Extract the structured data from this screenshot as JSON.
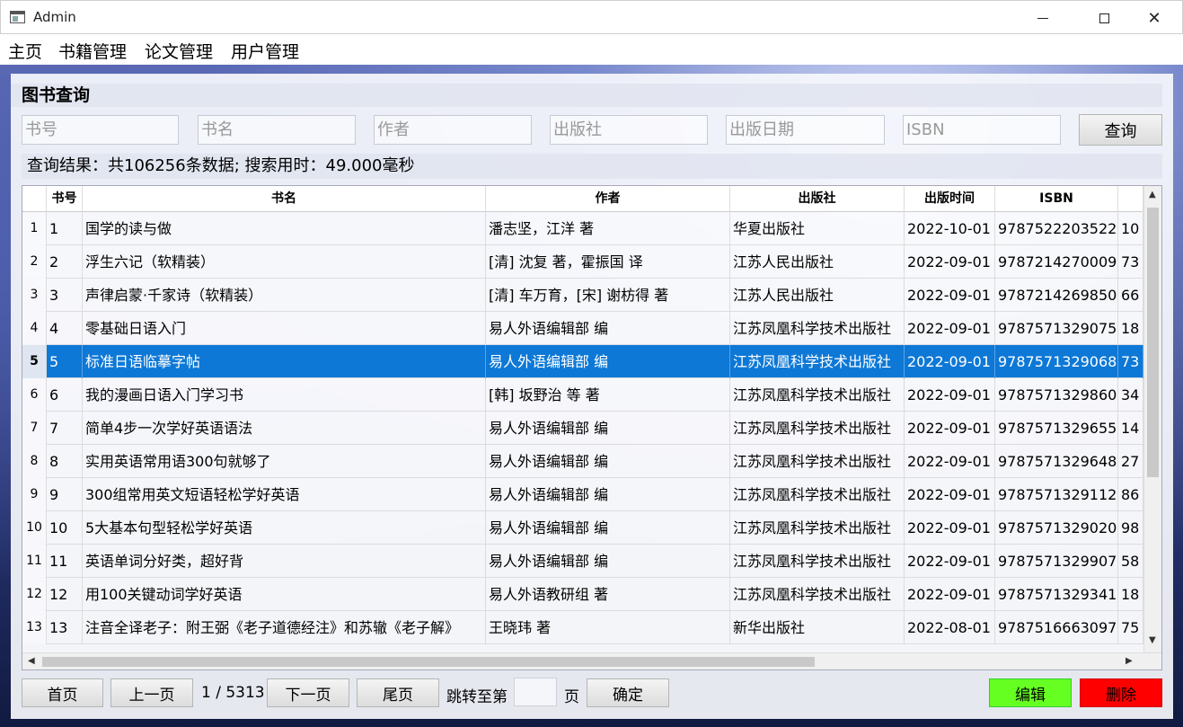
{
  "window": {
    "title": "Admin"
  },
  "menu": [
    "主页",
    "书籍管理",
    "论文管理",
    "用户管理"
  ],
  "section_title": "图书查询",
  "search": {
    "book_no": "书号",
    "book_name": "书名",
    "author": "作者",
    "publisher": "出版社",
    "publish_date": "出版日期",
    "isbn": "ISBN",
    "query_button": "查询"
  },
  "result_text": "查询结果：共106256条数据; 搜索用时：49.000毫秒",
  "table": {
    "columns": [
      "书号",
      "书名",
      "作者",
      "出版社",
      "出版时间",
      "ISBN",
      ""
    ],
    "selected_row": 5,
    "rows": [
      {
        "rn": "1",
        "id": "1",
        "name": "国学的读与做",
        "author": "潘志坚，江洋 著",
        "publisher": "华夏出版社",
        "date": "2022-10-01",
        "isbn": "9787522203522",
        "extra": "10"
      },
      {
        "rn": "2",
        "id": "2",
        "name": "浮生六记（软精装）",
        "author": "[清] 沈复 著，霍振国 译",
        "publisher": "江苏人民出版社",
        "date": "2022-09-01",
        "isbn": "9787214270009",
        "extra": "73"
      },
      {
        "rn": "3",
        "id": "3",
        "name": "声律启蒙·千家诗（软精装）",
        "author": "[清] 车万育，[宋] 谢枋得 著",
        "publisher": "江苏人民出版社",
        "date": "2022-09-01",
        "isbn": "9787214269850",
        "extra": "66"
      },
      {
        "rn": "4",
        "id": "4",
        "name": "零基础日语入门",
        "author": "易人外语编辑部 编",
        "publisher": "江苏凤凰科学技术出版社",
        "date": "2022-09-01",
        "isbn": "9787571329075",
        "extra": "18"
      },
      {
        "rn": "5",
        "id": "5",
        "name": "标准日语临摹字帖",
        "author": "易人外语编辑部 编",
        "publisher": "江苏凤凰科学技术出版社",
        "date": "2022-09-01",
        "isbn": "9787571329068",
        "extra": "73"
      },
      {
        "rn": "6",
        "id": "6",
        "name": "我的漫画日语入门学习书",
        "author": "[韩] 坂野治 等 著",
        "publisher": "江苏凤凰科学技术出版社",
        "date": "2022-09-01",
        "isbn": "9787571329860",
        "extra": "34"
      },
      {
        "rn": "7",
        "id": "7",
        "name": "简单4步一次学好英语语法",
        "author": "易人外语编辑部 编",
        "publisher": "江苏凤凰科学技术出版社",
        "date": "2022-09-01",
        "isbn": "9787571329655",
        "extra": "14"
      },
      {
        "rn": "8",
        "id": "8",
        "name": "实用英语常用语300句就够了",
        "author": "易人外语编辑部 编",
        "publisher": "江苏凤凰科学技术出版社",
        "date": "2022-09-01",
        "isbn": "9787571329648",
        "extra": "27"
      },
      {
        "rn": "9",
        "id": "9",
        "name": "300组常用英文短语轻松学好英语",
        "author": "易人外语编辑部 编",
        "publisher": "江苏凤凰科学技术出版社",
        "date": "2022-09-01",
        "isbn": "9787571329112",
        "extra": "86"
      },
      {
        "rn": "10",
        "id": "10",
        "name": "5大基本句型轻松学好英语",
        "author": "易人外语编辑部 编",
        "publisher": "江苏凤凰科学技术出版社",
        "date": "2022-09-01",
        "isbn": "9787571329020",
        "extra": "98"
      },
      {
        "rn": "11",
        "id": "11",
        "name": "英语单词分好类，超好背",
        "author": "易人外语编辑部 编",
        "publisher": "江苏凤凰科学技术出版社",
        "date": "2022-09-01",
        "isbn": "9787571329907",
        "extra": "58"
      },
      {
        "rn": "12",
        "id": "12",
        "name": "用100关键动词学好英语",
        "author": "易人外语教研组 著",
        "publisher": "江苏凤凰科学技术出版社",
        "date": "2022-09-01",
        "isbn": "9787571329341",
        "extra": "18"
      },
      {
        "rn": "13",
        "id": "13",
        "name": "注音全译老子：附王弼《老子道德经注》和苏辙《老子解》",
        "author": "王晓玮 著",
        "publisher": "新华出版社",
        "date": "2022-08-01",
        "isbn": "9787516663097",
        "extra": "75"
      }
    ]
  },
  "pagination": {
    "first": "首页",
    "prev": "上一页",
    "page_info": "1 / 5313",
    "next": "下一页",
    "last": "尾页",
    "jump_label": "跳转至第",
    "page_suffix": "页",
    "confirm": "确定"
  },
  "actions": {
    "edit": "编辑",
    "delete": "删除"
  },
  "colors": {
    "edit": "#66ff22",
    "delete": "#ff0000",
    "selection": "#0d78d6"
  }
}
